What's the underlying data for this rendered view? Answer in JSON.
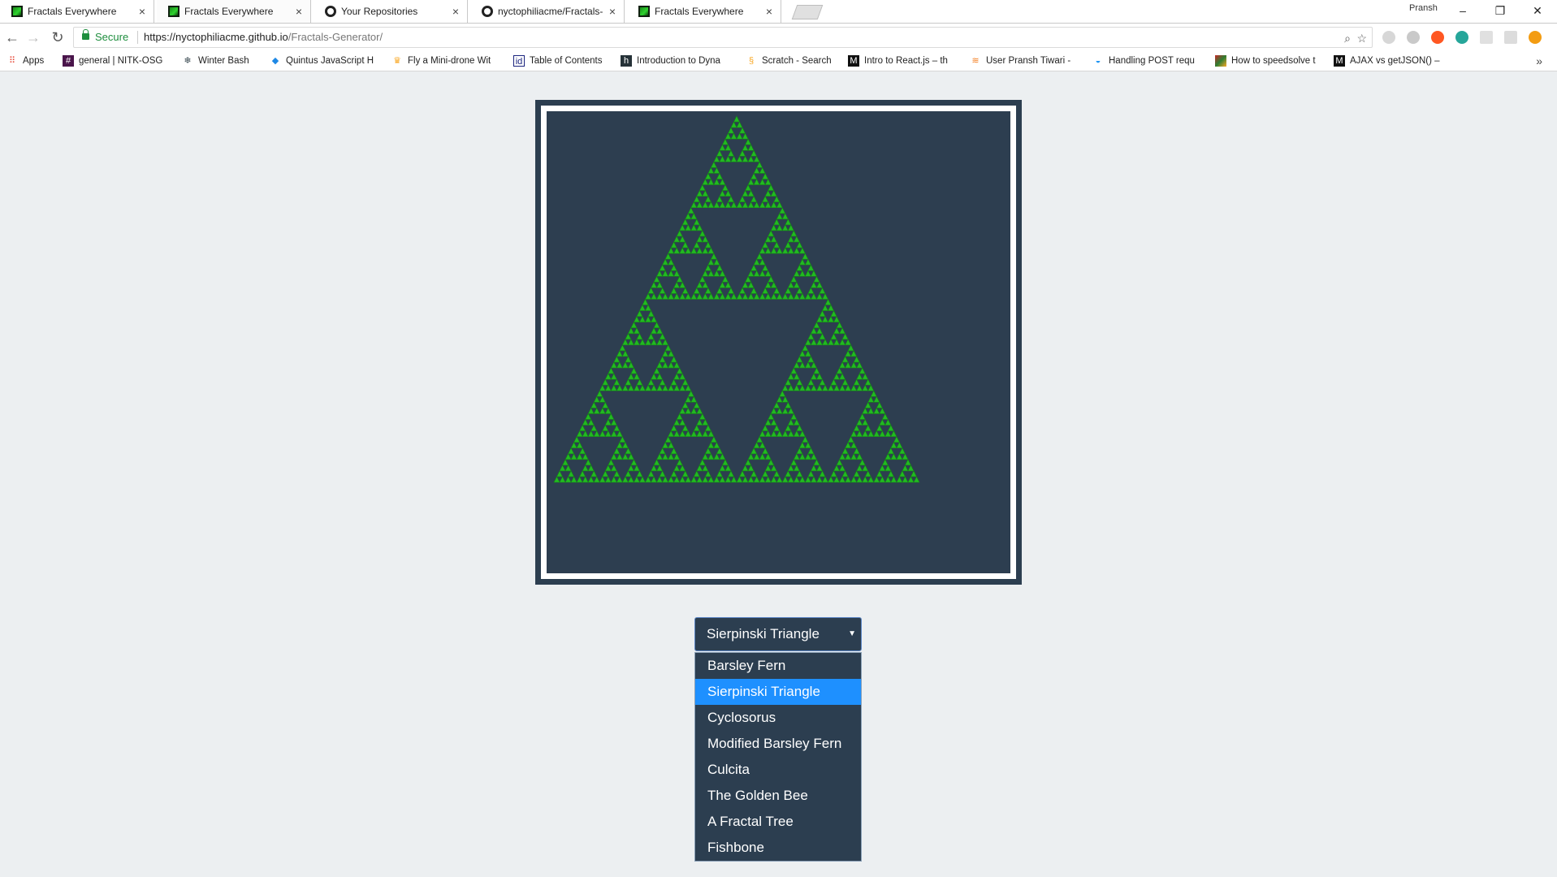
{
  "browser": {
    "tabs": [
      {
        "title": "Fractals Everywhere",
        "icon": "fractal-favicon-icon"
      },
      {
        "title": "Fractals Everywhere",
        "icon": "fractal-favicon-icon",
        "active": true
      },
      {
        "title": "Your Repositories",
        "icon": "github-icon"
      },
      {
        "title": "nyctophiliacme/Fractals-G",
        "icon": "github-icon"
      },
      {
        "title": "Fractals Everywhere",
        "icon": "fractal-favicon-icon"
      }
    ],
    "profile_name": "Pransh",
    "secure_label": "Secure",
    "url_host": "https://nyctophiliacme.github.io",
    "url_path": "/Fractals-Generator/",
    "bookmarks": [
      {
        "label": "Apps",
        "icon": "apps-grid-icon",
        "color": "#e74c3c"
      },
      {
        "label": "general | NITK-OSG",
        "icon": "slack-hash-icon",
        "color": "#4a154b"
      },
      {
        "label": "Winter Bash",
        "icon": "snowflake-icon",
        "color": "#37474f"
      },
      {
        "label": "Quintus JavaScript H",
        "icon": "quintus-icon",
        "color": "#1e88e5"
      },
      {
        "label": "Fly a Mini-drone Wit",
        "icon": "drone-icon",
        "color": "#f9a825"
      },
      {
        "label": "Table of Contents",
        "icon": "id-icon",
        "color": "#1a237e"
      },
      {
        "label": "Introduction to Dyna",
        "icon": "hackerearth-icon",
        "color": "#263238"
      },
      {
        "label": "Scratch - Search",
        "icon": "scratch-icon",
        "color": "#f9a825"
      },
      {
        "label": "Intro to React.js – th",
        "icon": "medium-icon",
        "color": "#111111"
      },
      {
        "label": "User Pransh Tiwari -",
        "icon": "stackoverflow-icon",
        "color": "#f48024"
      },
      {
        "label": "Handling POST requ",
        "icon": "codeacademy-icon",
        "color": "#2196f3"
      },
      {
        "label": "How to speedsolve t",
        "icon": "rubiks-cube-icon",
        "color": "#c62828"
      },
      {
        "label": "AJAX vs getJSON() –",
        "icon": "medium-icon",
        "color": "#111111"
      }
    ],
    "more_bookmarks_glyph": "»"
  },
  "fractal": {
    "type": "Sierpinski Triangle",
    "depth": 6,
    "fill_color": "#22b922",
    "background_color": "#2d3e50"
  },
  "selector": {
    "selected_value": "Sierpinski Triangle",
    "options": [
      "Barsley Fern",
      "Sierpinski Triangle",
      "Cyclosorus",
      "Modified Barsley Fern",
      "Culcita",
      "The Golden Bee",
      "A Fractal Tree",
      "Fishbone"
    ],
    "highlighted_index": 1
  }
}
